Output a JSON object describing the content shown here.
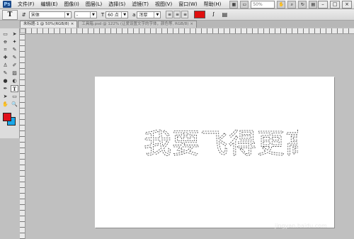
{
  "menubar": {
    "logo": "Ps",
    "items": [
      "文件(F)",
      "编辑(E)",
      "图像(I)",
      "图层(L)",
      "选择(S)",
      "滤镜(T)",
      "视图(V)",
      "窗口(W)",
      "帮助(H)"
    ],
    "zoom": "50%",
    "window_buttons": [
      "–",
      "□",
      "×"
    ]
  },
  "options": {
    "tool_icon": "T",
    "font_family": "宋体",
    "font_style": "-",
    "font_size": "60 点",
    "antialias": "浑厚",
    "text_color": "#e01010"
  },
  "tabs": [
    {
      "label": "未标题-1 @ 50%(RGB/8)",
      "close": "×",
      "active": true
    },
    {
      "label": "工具箱.psd @ 122% (让爱设置文字的字体，颜色等, RGB/8)",
      "close": "×",
      "active": false
    }
  ],
  "toolbox": {
    "tools": [
      "▭",
      "➤",
      "ꝋ",
      "✦",
      "⌗",
      "✎",
      "✚",
      "✎",
      "♙",
      "✐",
      "✎",
      "▨",
      "●",
      "◐",
      "✒",
      "T",
      "➤",
      "▭",
      "✋",
      "🔍"
    ],
    "foreground": "#e0101a",
    "background": "#1aa7e8"
  },
  "canvas": {
    "selection_text": "我要飞得更高"
  },
  "watermark": "jingyan.baidu.com"
}
